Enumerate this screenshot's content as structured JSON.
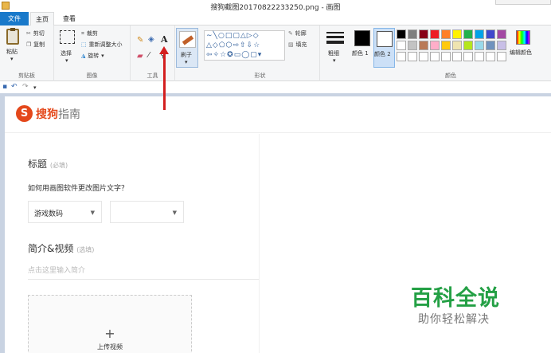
{
  "window": {
    "title": "搜狗截图20170822233250.png - 画图"
  },
  "tabs": {
    "file": "文件",
    "home": "主页",
    "view": "查看"
  },
  "ribbon": {
    "clipboard": {
      "paste": "粘贴",
      "cut": "剪切",
      "copy": "复制",
      "label": "剪贴板"
    },
    "image": {
      "select": "选择",
      "crop": "裁剪",
      "resize": "重新调整大小",
      "rotate": "旋转",
      "label": "图像"
    },
    "tools": {
      "label": "工具"
    },
    "brushes": {
      "label": "刷子"
    },
    "shapes": {
      "outline": "轮廓",
      "fill": "填充",
      "label": "形状"
    },
    "size": {
      "label": "粗细"
    },
    "colors": {
      "color1": "颜色 1",
      "color2": "颜色 2",
      "edit": "编辑颜色",
      "label": "颜色",
      "palette_row1": [
        "#000000",
        "#7f7f7f",
        "#880015",
        "#ed1c24",
        "#ff7f27",
        "#fff200",
        "#22b14c",
        "#00a2e8",
        "#3f48cc",
        "#a349a4"
      ],
      "palette_row2": [
        "#ffffff",
        "#c3c3c3",
        "#b97a57",
        "#ffaec9",
        "#ffc90e",
        "#efe4b0",
        "#b5e61d",
        "#99d9ea",
        "#7092be",
        "#c8bfe7"
      ]
    }
  },
  "page": {
    "logo": {
      "s": "S",
      "brand": "搜狗",
      "suffix": "指南"
    },
    "title_label": "标题",
    "title_hint": "(必填)",
    "question": "如何用画图软件更改图片文字？",
    "category": "游戏数码",
    "intro_label": "简介&视频",
    "intro_hint": "(选填)",
    "intro_placeholder": "点击这里输入简介",
    "upload_label": "上传视频"
  },
  "watermark": {
    "title": "百科全说",
    "subtitle": "助你轻松解决"
  }
}
